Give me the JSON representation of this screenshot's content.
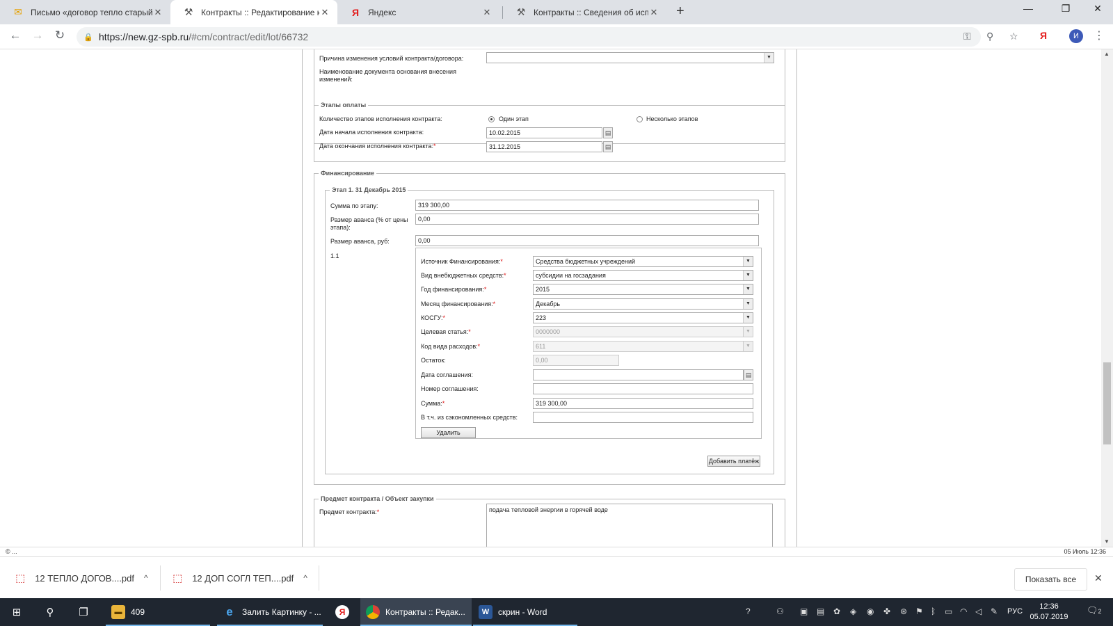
{
  "tabs": [
    {
      "title": "Письмо «договор тепло старый»",
      "icon": "mail-icon"
    },
    {
      "title": "Контракты :: Редактирование контракта",
      "icon": "tools-icon"
    },
    {
      "title": "Яндекс",
      "icon": "yandex-icon"
    },
    {
      "title": "Контракты :: Сведения об исполнении",
      "icon": "tools-icon"
    }
  ],
  "new_tab": "+",
  "window": {
    "minimize": "—",
    "restore": "❐",
    "close": "✕"
  },
  "address": {
    "host": "https://new.gz-spb.ru",
    "path": "/#cm/contract/edit/lot/66732"
  },
  "profile_initial": "И",
  "yandex_ext": "Я",
  "changes": {
    "reason_label": "Причина изменения условий контракта/договора:",
    "doc_label": "Наименование документа основания внесения изменений:"
  },
  "stages": {
    "legend": "Этапы оплаты",
    "count_label": "Количество этапов исполнения контракта:",
    "option_one": "Один этап",
    "option_many": "Несколько этапов",
    "start_label": "Дата начала исполнения контракта:",
    "start_value": "10.02.2015",
    "end_label": "Дата окончания исполнения контракта:",
    "end_value": "31.12.2015",
    "required_mark": "*"
  },
  "financing": {
    "legend": "Финансирование",
    "stage_legend": "Этап 1. 31 Декабрь 2015",
    "sum_label": "Сумма по этапу:",
    "sum_value": "319 300,00",
    "advance_pct_label": "Размер аванса (% от цены этапа):",
    "advance_pct_value": "0,00",
    "advance_rub_label": "Размер аванса, руб:",
    "advance_rub_value": "0,00",
    "payment_number": "1.1",
    "source_label": "Источник Финансирования:",
    "source_value": "Средства бюджетных учреждений",
    "kind_label": "Вид внебюджетных средств:",
    "kind_value": "субсидии на госзадания",
    "year_label": "Год финансирования:",
    "year_value": "2015",
    "month_label": "Месяц финансирования:",
    "month_value": "Декабрь",
    "kosgu_label": "КОСГУ:",
    "kosgu_value": "223",
    "target_label": "Целевая статья:",
    "target_value": "0000000",
    "expense_label": "Код вида расходов:",
    "expense_value": "611",
    "remainder_label": "Остаток:",
    "remainder_value": "0,00",
    "agreement_date_label": "Дата соглашения:",
    "agreement_number_label": "Номер соглашения:",
    "amount_label": "Сумма:",
    "amount_value": "319 300,00",
    "savings_label": "В т.ч. из сэкономленных средств:",
    "delete_button": "Удалить",
    "add_payment_button": "Добавить платёж"
  },
  "subject": {
    "legend": "Предмет контракта / Объект закупки",
    "label": "Предмет контракта:",
    "value": "подача тепловой энергии в горячей воде"
  },
  "status": {
    "left": "© ...",
    "right": "05 Июль 12:36"
  },
  "downloads": [
    {
      "name": "12 ТЕПЛО ДОГОВ....pdf"
    },
    {
      "name": "12 ДОП СОГЛ ТЕП....pdf"
    }
  ],
  "show_all": "Показать все",
  "taskbar": {
    "explorer_label": "409",
    "ie_label": "Залить Картинку - ...",
    "chrome_label": "Контракты :: Редак...",
    "word_label": "скрин - Word",
    "lang": "РУС",
    "time": "12:36",
    "date": "05.07.2019",
    "notifications": "2"
  }
}
